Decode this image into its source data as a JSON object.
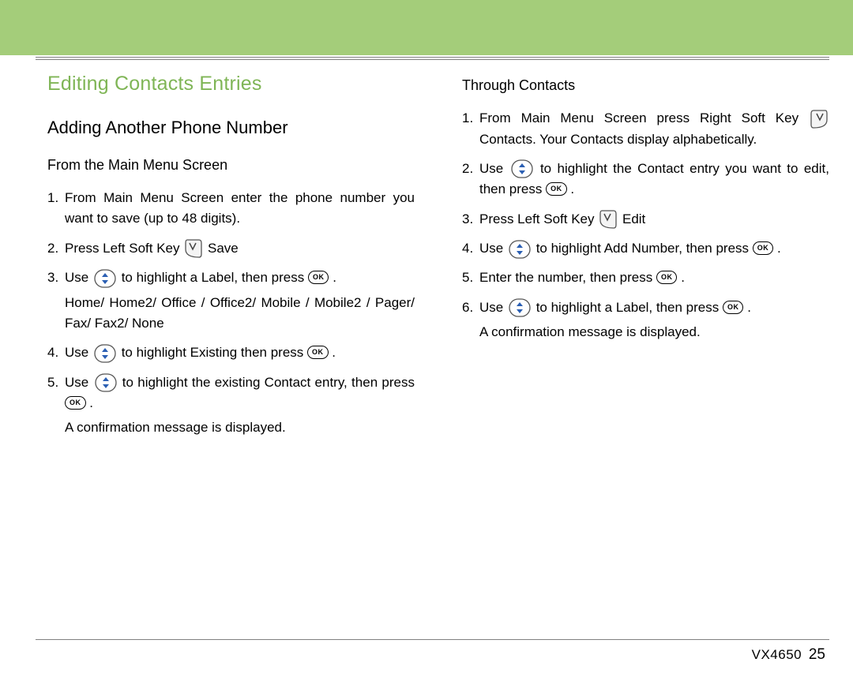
{
  "section_title": "Editing Contacts Entries",
  "subtitle": "Adding Another Phone Number",
  "left": {
    "subsection": "From the Main Menu Screen",
    "step1": "From Main Menu Screen enter the phone number you want to save (up to 48 digits).",
    "step2_a": "Press Left Soft Key ",
    "step2_b": " Save",
    "step3_a": "Use ",
    "step3_b": " to highlight a Label, then press ",
    "step3_c": ".",
    "step3_labels": "Home/ Home2/ Office / Office2/ Mobile / Mobile2 / Pager/ Fax/ Fax2/ None",
    "step4_a": "Use ",
    "step4_b": " to highlight Existing then press ",
    "step4_c": ".",
    "step5_a": "Use ",
    "step5_b": " to highlight the existing Contact entry, then press ",
    "step5_c": ".",
    "step5_confirm": "A confirmation message is displayed."
  },
  "right": {
    "subsection": "Through Contacts",
    "step1_a": "From Main Menu Screen press Right Soft Key ",
    "step1_b": " Contacts. Your Contacts display alphabetically.",
    "step2_a": "Use ",
    "step2_b": " to highlight the Contact entry you want to edit, then press ",
    "step2_c": ".",
    "step3_a": "Press Left Soft Key ",
    "step3_b": " Edit",
    "step4_a": "Use ",
    "step4_b": " to highlight Add Number, then press ",
    "step4_c": ".",
    "step5_a": "Enter the number, then press ",
    "step5_b": ".",
    "step6_a": "Use ",
    "step6_b": " to highlight a Label, then press ",
    "step6_c": ".",
    "step6_confirm": "A confirmation message is displayed."
  },
  "footer": {
    "model": "VX4650",
    "page": "25"
  },
  "ok_label": "OK"
}
